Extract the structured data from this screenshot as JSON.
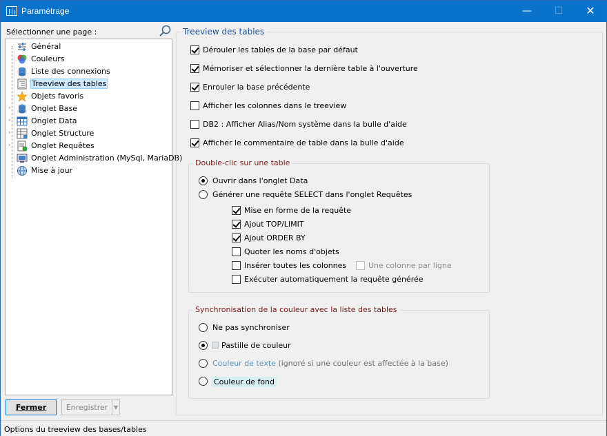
{
  "window": {
    "title": "Paramétrage"
  },
  "left": {
    "label": "Sélectionner une page :",
    "tree": [
      {
        "label": "Général",
        "icon": "sliders-icon",
        "expandable": false,
        "selected": false
      },
      {
        "label": "Couleurs",
        "icon": "color-palette-icon",
        "expandable": false,
        "selected": false
      },
      {
        "label": "Liste des connexions",
        "icon": "database-icon",
        "expandable": false,
        "selected": false
      },
      {
        "label": "Treeview des tables",
        "icon": "treeview-icon",
        "expandable": false,
        "selected": true
      },
      {
        "label": "Objets favoris",
        "icon": "star-icon",
        "expandable": false,
        "selected": false
      },
      {
        "label": "Onglet Base",
        "icon": "database-icon",
        "expandable": true,
        "selected": false
      },
      {
        "label": "Onglet Data",
        "icon": "grid-icon",
        "expandable": true,
        "selected": false
      },
      {
        "label": "Onglet Structure",
        "icon": "structure-icon",
        "expandable": true,
        "selected": false
      },
      {
        "label": "Onglet Requêtes",
        "icon": "query-icon",
        "expandable": true,
        "selected": false
      },
      {
        "label": "Onglet Administration (MySql, MariaDB)",
        "icon": "admin-icon",
        "expandable": false,
        "selected": false
      },
      {
        "label": "Mise à jour",
        "icon": "globe-icon",
        "expandable": false,
        "selected": false
      }
    ],
    "close_label": "Fermer",
    "save_label": "Enregistrer"
  },
  "main": {
    "title": "Treeview des tables",
    "options": [
      {
        "label": "Dérouler les tables de la base par défaut",
        "checked": true
      },
      {
        "label": "Mémoriser et sélectionner la dernière table à l'ouverture",
        "checked": true
      },
      {
        "label": "Enrouler la base précédente",
        "checked": true
      },
      {
        "label": "Afficher les colonnes dans le treeview",
        "checked": false
      },
      {
        "label": "DB2 : Afficher Alias/Nom système dans la bulle d'aide",
        "checked": false
      },
      {
        "label": "Afficher le commentaire de table dans la bulle d'aide",
        "checked": true
      }
    ],
    "double_click": {
      "title": "Double-clic sur une table",
      "radio_open": "Ouvrir dans l'onglet Data",
      "radio_open_checked": true,
      "radio_generate": "Générer une requête SELECT dans l'onglet Requêtes",
      "radio_generate_checked": false,
      "sub_options": [
        {
          "label": "Mise en forme de la requête",
          "checked": true
        },
        {
          "label": "Ajout TOP/LIMIT",
          "checked": true
        },
        {
          "label": "Ajout ORDER BY",
          "checked": true
        },
        {
          "label": "Quoter les noms d'objets",
          "checked": false
        },
        {
          "label": "Insérer toutes les colonnes",
          "checked": false
        },
        {
          "label": "Exécuter automatiquement la requête générée",
          "checked": false
        }
      ],
      "one_column_per_line": {
        "label": "Une colonne par ligne",
        "checked": false,
        "enabled": false
      }
    },
    "sync": {
      "title": "Synchronisation de la couleur avec la liste des tables",
      "options": [
        {
          "label": "Ne pas synchroniser",
          "checked": false
        },
        {
          "label": "Pastille de couleur",
          "checked": true
        },
        {
          "label": "Couleur de texte",
          "note": "(ignoré si une couleur est affectée à la base)",
          "checked": false
        },
        {
          "label": "Couleur de fond",
          "checked": false
        }
      ]
    }
  },
  "status": {
    "text": "Options du treeview des bases/tables"
  }
}
